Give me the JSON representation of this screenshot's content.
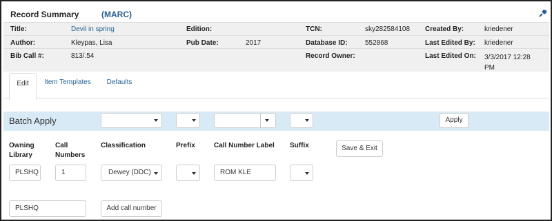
{
  "header": {
    "title": "Record Summary",
    "format": "(MARC)"
  },
  "summary": {
    "row1": [
      {
        "label": "Title:",
        "value": "Devil in spring"
      },
      {
        "label": "Edition:",
        "value": ""
      },
      {
        "label": "TCN:",
        "value": "sky282584108"
      },
      {
        "label": "Created By:",
        "value": "kriedener"
      }
    ],
    "row2": [
      {
        "label": "Author:",
        "value": "Kleypas, Lisa"
      },
      {
        "label": "Pub Date:",
        "value": "2017"
      },
      {
        "label": "Database ID:",
        "value": "552868"
      },
      {
        "label": "Last Edited By:",
        "value": "kriedener"
      }
    ],
    "row3": [
      {
        "label": "Bib Call #:",
        "value": "813/.54"
      },
      {
        "label": "Record Owner:",
        "value": ""
      },
      {
        "label": "Last Edited On:",
        "value": "3/3/2017 12:28 PM"
      }
    ]
  },
  "tabs": [
    "Edit",
    "Item Templates",
    "Defaults"
  ],
  "batch": {
    "label": "Batch Apply",
    "apply": "Apply"
  },
  "columns": {
    "owning_library": "Owning Library",
    "call_numbers": "Call Numbers",
    "classification": "Classification",
    "prefix": "Prefix",
    "call_number_label": "Call Number Label",
    "suffix": "Suffix",
    "save_exit": "Save & Exit"
  },
  "row": {
    "owning_library": "PLSHQ",
    "call_numbers": "1",
    "classification": "Dewey (DDC)",
    "call_number_label": "ROM KLE"
  },
  "footer": {
    "library": "PLSHQ",
    "add_call_number": "Add call number"
  },
  "colors": {
    "link": "#2a6496",
    "batch_bg": "#d9eaf7",
    "summary_bg": "#f0f0f0"
  },
  "icons": {
    "pin": "pin-icon"
  }
}
